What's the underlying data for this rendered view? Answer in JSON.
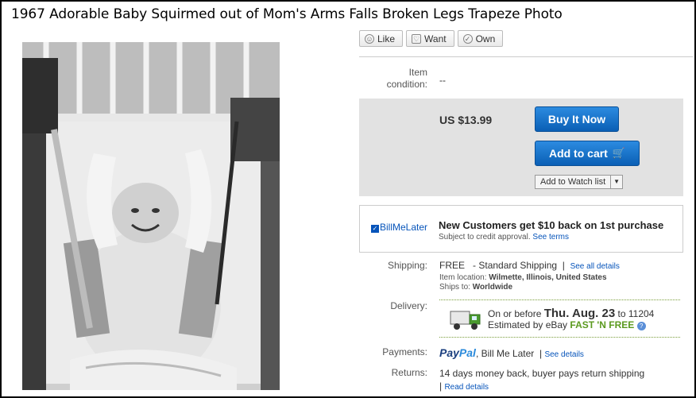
{
  "title": "1967 Adorable Baby Squirmed out of Mom's Arms Falls Broken Legs Trapeze Photo",
  "social": [
    {
      "icon": "smile-icon",
      "label": "Like"
    },
    {
      "icon": "heart-icon",
      "label": "Want"
    },
    {
      "icon": "check-icon",
      "label": "Own"
    }
  ],
  "condition": {
    "label": "Item condition:",
    "value": "--"
  },
  "price": "US $13.99",
  "buttons": {
    "buy_now": "Buy It Now",
    "add_to_cart": "Add to cart",
    "watch": "Add to Watch list"
  },
  "billmelater": {
    "logo": "BillMeLater",
    "headline": "New Customers get $10 back on 1st purchase",
    "sub": "Subject to credit approval.",
    "link": "See terms"
  },
  "shipping": {
    "label": "Shipping:",
    "cost": "FREE",
    "method": "- Standard Shipping",
    "link": "See all details",
    "location_label": "Item location:",
    "location": "Wilmette, Illinois, United States",
    "ships_to_label": "Ships to:",
    "ships_to": "Worldwide"
  },
  "delivery": {
    "label": "Delivery:",
    "prefix": "On or before",
    "date": "Thu. Aug. 23",
    "to": "to 11204",
    "estimated": "Estimated by eBay",
    "fast": "FAST 'N FREE"
  },
  "payments": {
    "label": "Payments:",
    "paypal_a": "Pay",
    "paypal_b": "Pal",
    "bill": "Bill Me Later",
    "link": "See details"
  },
  "returns": {
    "label": "Returns:",
    "text_a": "14 days money back, buyer pays return",
    "text_b": "shipping",
    "link": "Read details"
  },
  "colors": {
    "accent": "#0654ba",
    "buy_button": "#1b74cf",
    "fast_green": "#5b9a1f",
    "buybox_bg": "#e2e2e2"
  }
}
